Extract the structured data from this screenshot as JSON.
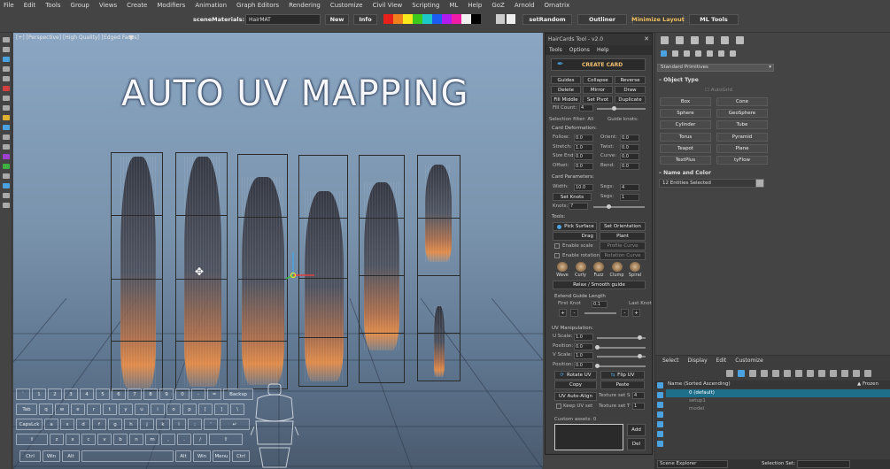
{
  "menubar": {
    "items": [
      "File",
      "Edit",
      "Tools",
      "Group",
      "Views",
      "Create",
      "Modifiers",
      "Animation",
      "Graph Editors",
      "Rendering",
      "Customize",
      "Civil View",
      "Scripting",
      "ML",
      "Help",
      "GoZ",
      "Arnold",
      "Ornatrix"
    ]
  },
  "toolbar": {
    "scene_materials_label": "sceneMaterials:",
    "scene_materials_value": "HairMAT",
    "new_label": "New",
    "info_label": "Info",
    "set_random_label": "setRandom",
    "outliner_label": "Outliner",
    "minimize_layout_label": "Minimize Layout",
    "ml_tools_label": "ML Tools",
    "swatch_colors": [
      "#e8201c",
      "#f0801c",
      "#f8e81c",
      "#3cc81c",
      "#1cc8c8",
      "#1c5cf0",
      "#b01cf0",
      "#f01ca8",
      "#f0f0f0",
      "#000000"
    ]
  },
  "viewport": {
    "label": "[+] [Perspective] [High Quality] [Edged Faces]",
    "title": "AUTO UV MAPPING"
  },
  "keyboard": {
    "row1": [
      "`",
      "1",
      "2",
      "3",
      "4",
      "5",
      "6",
      "7",
      "8",
      "9",
      "0",
      "-",
      "=",
      "Backsp"
    ],
    "row2": [
      "Tab",
      "q",
      "w",
      "e",
      "r",
      "t",
      "y",
      "u",
      "i",
      "o",
      "p",
      "[",
      "]",
      "\\"
    ],
    "row3": [
      "CapsLck",
      "a",
      "s",
      "d",
      "f",
      "g",
      "h",
      "j",
      "k",
      "l",
      ";",
      "'",
      "↵"
    ],
    "row4": [
      "⇧",
      "z",
      "x",
      "c",
      "v",
      "b",
      "n",
      "m",
      ",",
      ".",
      "/",
      "⇧"
    ],
    "row5": [
      "Ctrl",
      "Win",
      "Alt",
      "Alt",
      "Win",
      "Menu",
      "Ctrl"
    ]
  },
  "haircards": {
    "title": "HairCards Tool - v2.0",
    "menu": [
      "Tools",
      "Options",
      "Help"
    ],
    "create_card": "CREATE CARD",
    "buttons_row1": [
      "Guides",
      "Collapse",
      "Reverse"
    ],
    "buttons_row2": [
      "Delete",
      "Mirror",
      "Draw"
    ],
    "buttons_row3": [
      "Fill Middle",
      "Set Pivot",
      "Duplicate"
    ],
    "fill_count_label": "Fill Count:",
    "fill_count_value": "4",
    "selection_filter": "Selection filter: All",
    "guide_knots": "Guide knots:",
    "card_deformation": "Card Deformation:",
    "deform_left": [
      {
        "label": "Follow:",
        "value": "0.0"
      },
      {
        "label": "Stretch:",
        "value": "1.0"
      },
      {
        "label": "Size End:",
        "value": "0.0"
      },
      {
        "label": "Offset:",
        "value": "0.0"
      }
    ],
    "deform_right": [
      {
        "label": "Orient:",
        "value": "0.0"
      },
      {
        "label": "Twist:",
        "value": "0.0"
      },
      {
        "label": "Curve:",
        "value": "0.0"
      },
      {
        "label": "Bend:",
        "value": "0.0"
      }
    ],
    "card_parameters": "Card Parameters:",
    "width_label": "Width:",
    "width_value": "10.0",
    "segs_label": "Segs:",
    "segs_value": "4",
    "set_knots": "Set Knots",
    "segs2_label": "Segs:",
    "segs2_value": "1",
    "knots_label": "Knots:",
    "knots_value": "7",
    "tools_label": "Tools:",
    "pick_surface": "Pick Surface",
    "set_orientation": "Set Orientation",
    "drag": "Drag",
    "plant": "Plant",
    "enable_scale": "Enable scale",
    "profile_curve": "Profile Curve",
    "enable_rotation": "Enable rotation",
    "rotation_curve": "Rotation Curve",
    "styles": [
      "Wave",
      "Curly",
      "Fuzz",
      "Clump",
      "Spiral"
    ],
    "relax_smooth": "Relax / Smooth guide",
    "extend_label": "Extend Guide Length",
    "first_knot": "First Knot",
    "first_knot_value": "0.1",
    "last_knot": "Last Knot",
    "uv_manip": "UV Manipulation:",
    "uv_rows": [
      {
        "label": "U Scale:",
        "value": "1.0"
      },
      {
        "label": "Position:",
        "value": "0.0"
      },
      {
        "label": "V Scale:",
        "value": "1.0"
      },
      {
        "label": "Position:",
        "value": "0.0"
      }
    ],
    "rotate_uv": "Rotate UV",
    "flip_uv": "Flip UV",
    "copy": "Copy",
    "paste": "Paste",
    "uv_auto_align": "UV Auto-Align",
    "texture_set_s": "Texture set S",
    "texture_set_s_value": "4",
    "keep_uv_set": "Keep UV set",
    "texture_set_t": "Texture set T",
    "texture_set_t_value": "1",
    "custom_assets": "Custom assets: 0",
    "add": "Add",
    "del": "Del"
  },
  "rightpanel": {
    "dropdown": "Standard Primitives",
    "object_type": "Object Type",
    "autogrid": "AutoGrid",
    "objects": [
      "Box",
      "Cone",
      "Sphere",
      "GeoSphere",
      "Cylinder",
      "Tube",
      "Torus",
      "Pyramid",
      "Teapot",
      "Plane",
      "TextPlus",
      "tyFlow"
    ],
    "name_color": "Name and Color",
    "name_value": "12 Entities Selected",
    "name_color_swatch": "#b0b0b0",
    "scene_menu": [
      "Select",
      "Display",
      "Edit",
      "Customize"
    ],
    "col_name": "Name (Sorted Ascending)",
    "col_frozen": "▲ Frozen",
    "rows": [
      "0 (default)",
      "setup1",
      "model"
    ],
    "scene_explorer": "Scene Explorer",
    "selection_set": "Selection Set:"
  }
}
